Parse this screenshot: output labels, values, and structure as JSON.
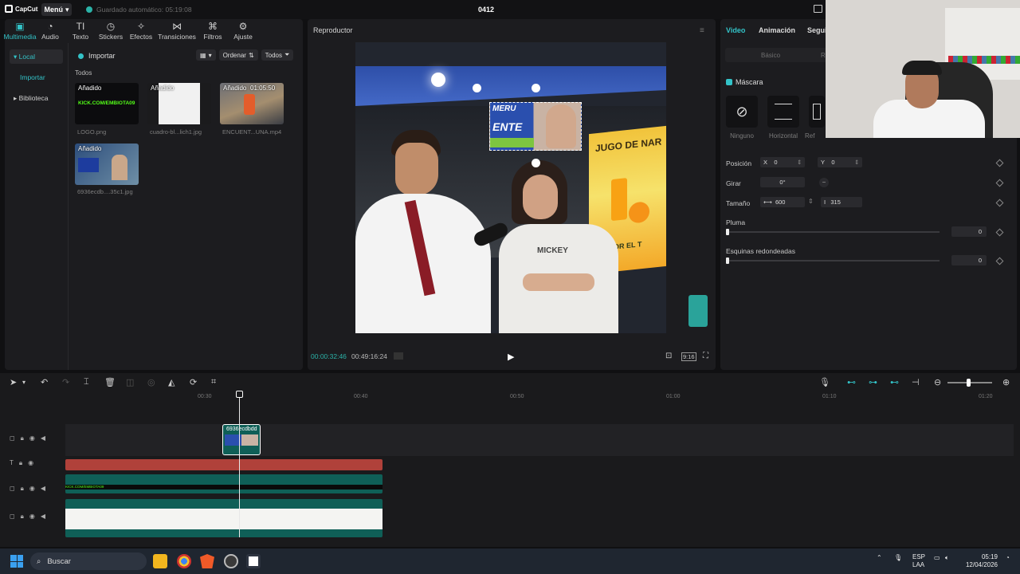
{
  "titlebar": {
    "app_name": "CapCut",
    "menu_label": "Menú",
    "autosave": "Guardado automático: 05:19:08",
    "project_title": "0412"
  },
  "media": {
    "tabs": [
      {
        "label": "Multimedia",
        "icon": "media-icon"
      },
      {
        "label": "Audio",
        "icon": "audio-icon"
      },
      {
        "label": "Texto",
        "icon": "text-icon"
      },
      {
        "label": "Stickers",
        "icon": "sticker-icon"
      },
      {
        "label": "Efectos",
        "icon": "effects-icon"
      },
      {
        "label": "Transiciones",
        "icon": "transition-icon"
      },
      {
        "label": "Filtros",
        "icon": "filter-icon"
      },
      {
        "label": "Ajuste",
        "icon": "adjust-icon"
      }
    ],
    "sidebar": {
      "local": "Local",
      "importar": "Importar",
      "biblioteca": "Biblioteca"
    },
    "import_label": "Importar",
    "sort_label": "Ordenar",
    "filter_label": "Todos",
    "section": "Todos",
    "items": [
      {
        "badge": "Añadido",
        "caption": "LOGO.png",
        "text": "KICK.COM/EMBIOTA09"
      },
      {
        "badge": "Añadido",
        "caption": "cuadro-bl...lich1.jpg"
      },
      {
        "badge": "Añadido",
        "duration": "01:05:50",
        "caption": "ENCUENT...UNA.mp4"
      },
      {
        "badge": "Añadido",
        "caption": "6936ecdb....35c1.jpg"
      }
    ]
  },
  "player": {
    "title": "Reproductor",
    "time_current": "00:00:32:46",
    "time_total": "00:49:16:24",
    "ratio": "9:16",
    "overlay_text_1": "MERU",
    "overlay_text_2": "ENTE",
    "sign_text": "JUGO DE NAR",
    "sign_text_2": "VEN POR EL T",
    "shirt_text": "MICKEY"
  },
  "inspector": {
    "tabs": [
      "Video",
      "Animación",
      "Segui"
    ],
    "subtabs": [
      "Básico",
      "Re"
    ],
    "mask_label": "Máscara",
    "mask_options": [
      "Ninguno",
      "Horizontal",
      "Ref"
    ],
    "position_label": "Posición",
    "x_label": "X",
    "x_value": "0",
    "y_label": "Y",
    "y_value": "0",
    "rotate_label": "Girar",
    "rotate_value": "0°",
    "size_label": "Tamaño",
    "width_value": "600",
    "height_value": "315",
    "feather_label": "Pluma",
    "feather_value": "0",
    "corners_label": "Esquinas redondeadas",
    "corners_value": "0"
  },
  "timeline": {
    "ruler": [
      "00:30",
      "00:40",
      "00:50",
      "01:00",
      "01:10",
      "01:20"
    ],
    "clip_label": "6936ecdbdd",
    "track_text": "KICK.COM/EMBIOTA09"
  },
  "taskbar": {
    "search_placeholder": "Buscar",
    "lang_1": "ESP",
    "lang_2": "LAA",
    "time": "05:19",
    "date": "12/04/2026"
  },
  "colors": {
    "accent": "#33c3c8",
    "text_track": "#b0413a",
    "video_track": "#0f5f57"
  }
}
